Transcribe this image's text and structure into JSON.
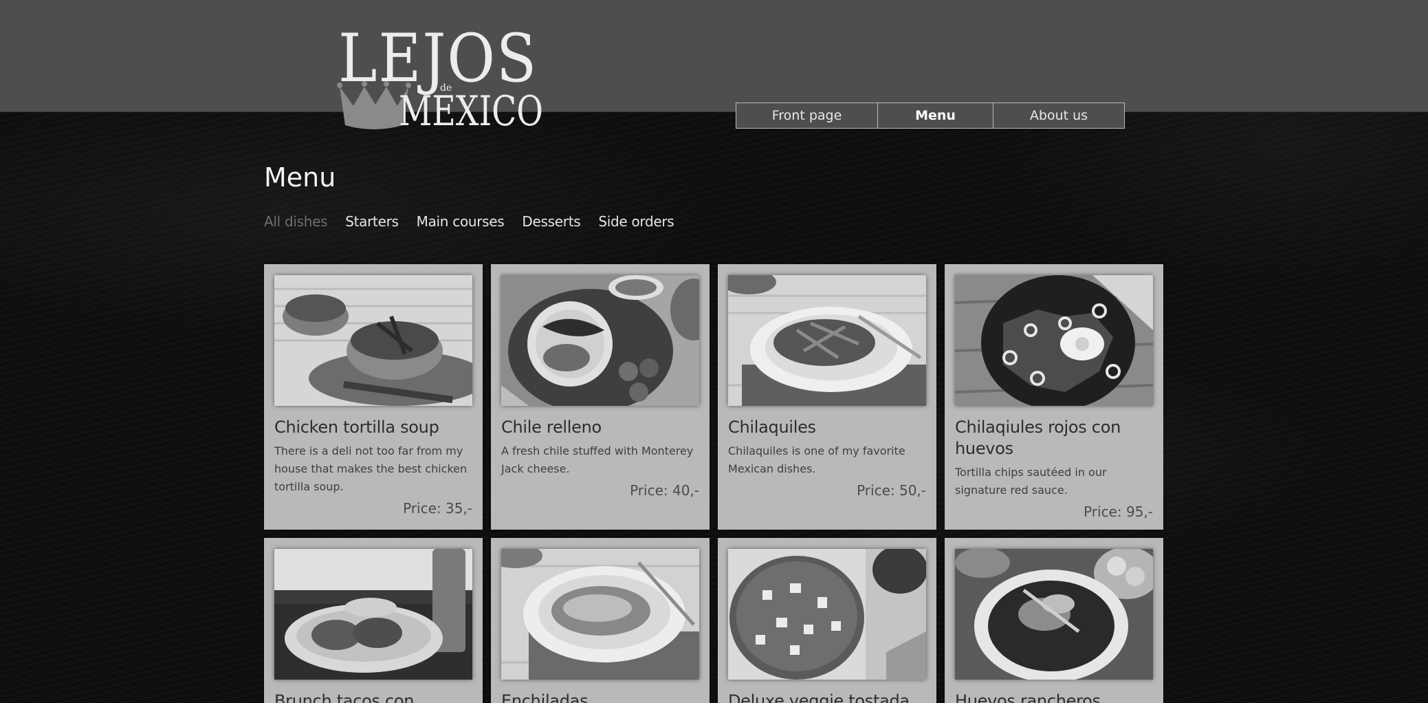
{
  "logo": {
    "line1": "LEJOS",
    "small": "de",
    "line2": "MEXICO"
  },
  "nav": {
    "items": [
      {
        "label": "Front page",
        "active": false
      },
      {
        "label": "Menu",
        "active": true
      },
      {
        "label": "About us",
        "active": false
      }
    ]
  },
  "page": {
    "title": "Menu"
  },
  "filters": [
    {
      "label": "All dishes",
      "active": true
    },
    {
      "label": "Starters",
      "active": false
    },
    {
      "label": "Main courses",
      "active": false
    },
    {
      "label": "Desserts",
      "active": false
    },
    {
      "label": "Side orders",
      "active": false
    }
  ],
  "dishes": [
    {
      "name": "Chicken tortilla soup",
      "description": "There is a deli not too far from my house that makes the best chicken tortilla soup.",
      "price": "Price: 35,-",
      "photo_icon": "soup-bowl-photo"
    },
    {
      "name": "Chile relleno",
      "description": "A fresh chile stuffed with Monterey Jack cheese.",
      "price": "Price: 40,-",
      "photo_icon": "stuffed-chile-photo"
    },
    {
      "name": "Chilaquiles",
      "description": "Chilaquiles is one of my favorite Mexican dishes.",
      "price": "Price: 50,-",
      "photo_icon": "chilaquiles-plate-photo"
    },
    {
      "name": "Chilaqiules rojos con huevos",
      "description": "Tortilla chips sautéed in our signature red sauce.",
      "price": "Price: 95,-",
      "photo_icon": "chilaquiles-egg-photo"
    },
    {
      "name": "Brunch tacos con",
      "description": "",
      "price": "",
      "photo_icon": "tacos-plate-photo"
    },
    {
      "name": "Enchiladas",
      "description": "",
      "price": "",
      "photo_icon": "enchiladas-plate-photo"
    },
    {
      "name": "Deluxe veggie tostada",
      "description": "",
      "price": "",
      "photo_icon": "tostada-photo"
    },
    {
      "name": "Huevos rancheros",
      "description": "",
      "price": "",
      "photo_icon": "huevos-rancheros-photo"
    }
  ]
}
